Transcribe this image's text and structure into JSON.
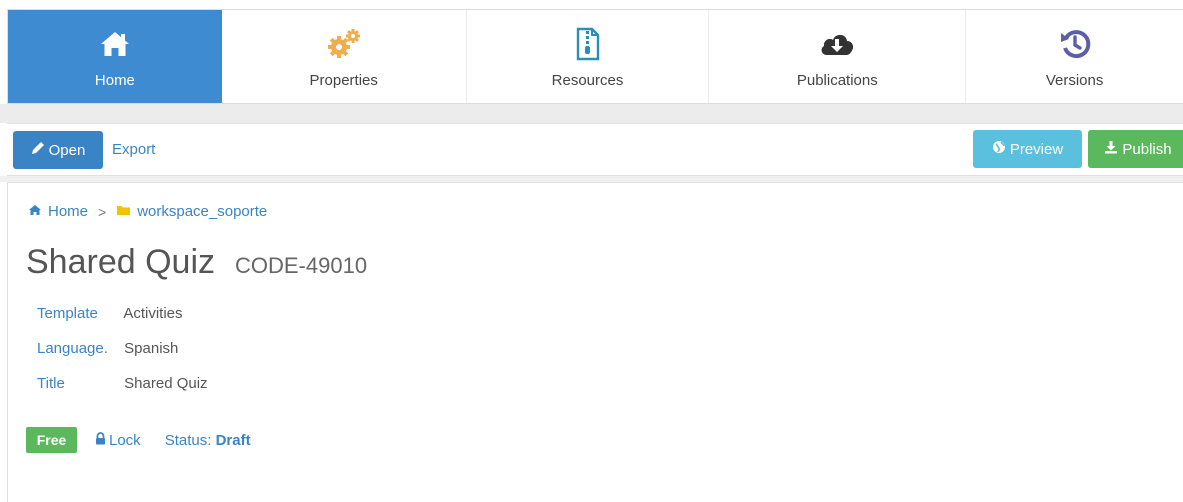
{
  "tabs": [
    {
      "label": "Home",
      "icon": "home-icon"
    },
    {
      "label": "Properties",
      "icon": "gears-icon"
    },
    {
      "label": "Resources",
      "icon": "zip-file-icon"
    },
    {
      "label": "Publications",
      "icon": "cloud-download-icon"
    },
    {
      "label": "Versions",
      "icon": "history-icon"
    }
  ],
  "toolbar": {
    "open_label": "Open",
    "export_label": "Export",
    "preview_label": "Preview",
    "publish_label": "Publish"
  },
  "breadcrumb": {
    "home": "Home",
    "separator": ">",
    "folder": "workspace_soporte"
  },
  "document": {
    "title": "Shared Quiz",
    "code": "CODE-49010"
  },
  "properties": [
    {
      "key": "Template",
      "value": "Activities"
    },
    {
      "key": "Language.",
      "value": "Spanish"
    },
    {
      "key": "Title",
      "value": "Shared Quiz"
    }
  ],
  "status": {
    "badge": "Free",
    "lock_label": "Lock",
    "status_label": "Status:",
    "status_value": "Draft"
  },
  "colors": {
    "primary": "#3f8bd1",
    "info": "#5bc0de",
    "success": "#5cb85c",
    "gears": "#f0ad4e",
    "versions": "#5b5fa8",
    "folder": "#f4c300"
  }
}
